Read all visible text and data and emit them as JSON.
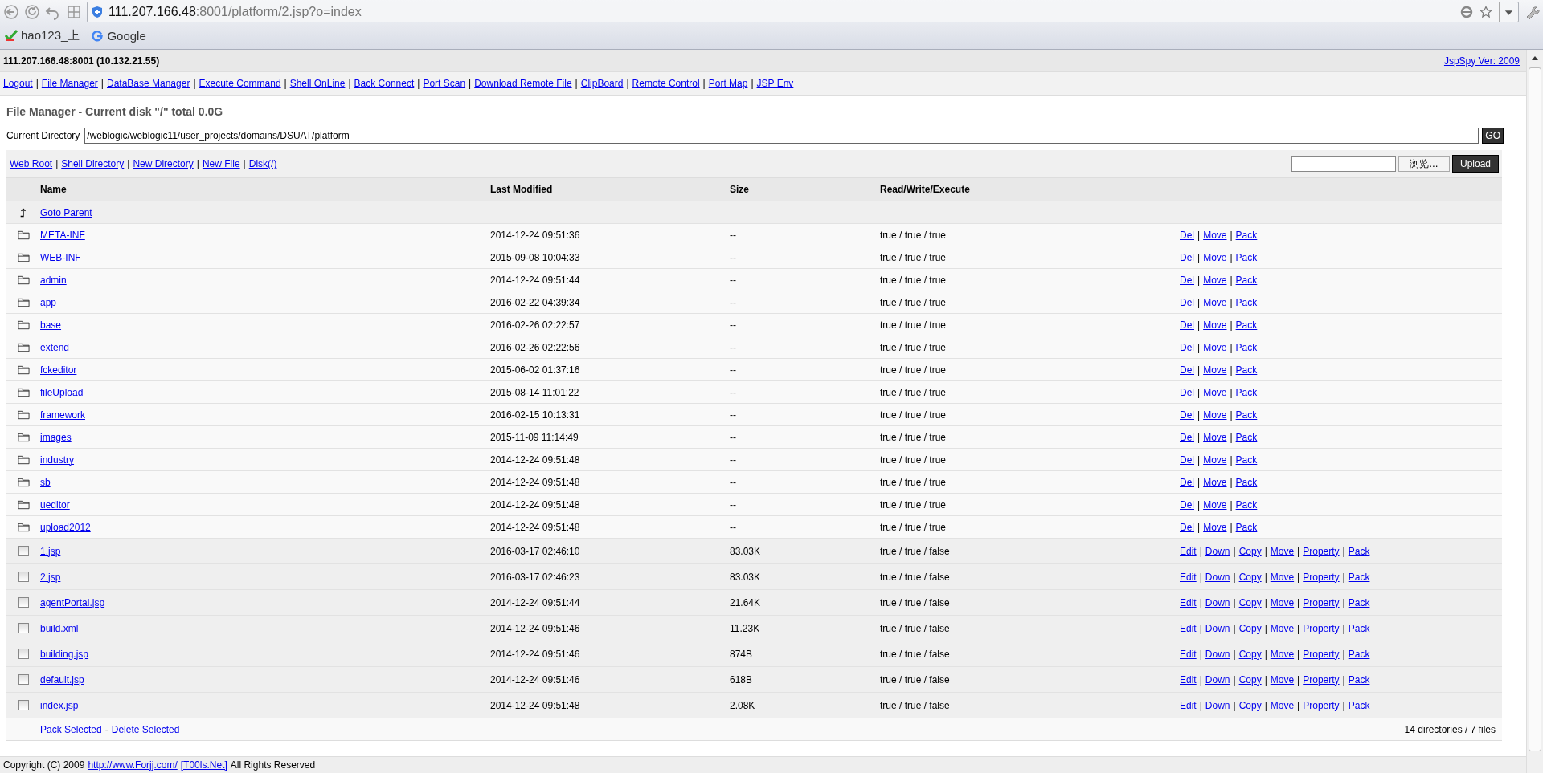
{
  "browser": {
    "url_host": "111.207.166.48",
    "url_path": ":8001/platform/2.jsp?o=index",
    "bookmarks": [
      {
        "label": "hao123_上",
        "kind": "check"
      },
      {
        "label": "Google",
        "kind": "letter"
      }
    ]
  },
  "header": {
    "host": "111.207.166.48:8001 (10.132.21.55)",
    "version_link": "JspSpy Ver: 2009"
  },
  "nav": {
    "separator": "|",
    "links": [
      "Logout",
      "File Manager",
      "DataBase Manager",
      "Execute Command",
      "Shell OnLine",
      "Back Connect",
      "Port Scan",
      "Download Remote File",
      "ClipBoard",
      "Remote Control",
      "Port Map",
      "JSP Env"
    ]
  },
  "title": "File Manager - Current disk \"/\" total 0.0G",
  "current_directory": {
    "label": "Current Directory",
    "value": "/weblogic/weblogic11/user_projects/domains/DSUAT/platform",
    "button": "GO"
  },
  "toolbar": {
    "separator": "|",
    "links": [
      "Web Root",
      "Shell Directory",
      "New Directory",
      "New File",
      "Disk(/)"
    ],
    "browse_button": "浏览...",
    "upload_button": "Upload"
  },
  "table": {
    "columns": [
      "Name",
      "Last Modified",
      "Size",
      "Read/Write/Execute"
    ],
    "parent_link": "Goto Parent",
    "separator": "|",
    "directories": [
      {
        "name": "META-INF",
        "modified": "2014-12-24 09:51:36",
        "size": "--",
        "permissions": "true / true / true",
        "actions": [
          "Del",
          "Move",
          "Pack"
        ]
      },
      {
        "name": "WEB-INF",
        "modified": "2015-09-08 10:04:33",
        "size": "--",
        "permissions": "true / true / true",
        "actions": [
          "Del",
          "Move",
          "Pack"
        ]
      },
      {
        "name": "admin",
        "modified": "2014-12-24 09:51:44",
        "size": "--",
        "permissions": "true / true / true",
        "actions": [
          "Del",
          "Move",
          "Pack"
        ]
      },
      {
        "name": "app",
        "modified": "2016-02-22 04:39:34",
        "size": "--",
        "permissions": "true / true / true",
        "actions": [
          "Del",
          "Move",
          "Pack"
        ]
      },
      {
        "name": "base",
        "modified": "2016-02-26 02:22:57",
        "size": "--",
        "permissions": "true / true / true",
        "actions": [
          "Del",
          "Move",
          "Pack"
        ]
      },
      {
        "name": "extend",
        "modified": "2016-02-26 02:22:56",
        "size": "--",
        "permissions": "true / true / true",
        "actions": [
          "Del",
          "Move",
          "Pack"
        ]
      },
      {
        "name": "fckeditor",
        "modified": "2015-06-02 01:37:16",
        "size": "--",
        "permissions": "true / true / true",
        "actions": [
          "Del",
          "Move",
          "Pack"
        ]
      },
      {
        "name": "fileUpload",
        "modified": "2015-08-14 11:01:22",
        "size": "--",
        "permissions": "true / true / true",
        "actions": [
          "Del",
          "Move",
          "Pack"
        ]
      },
      {
        "name": "framework",
        "modified": "2016-02-15 10:13:31",
        "size": "--",
        "permissions": "true / true / true",
        "actions": [
          "Del",
          "Move",
          "Pack"
        ]
      },
      {
        "name": "images",
        "modified": "2015-11-09 11:14:49",
        "size": "--",
        "permissions": "true / true / true",
        "actions": [
          "Del",
          "Move",
          "Pack"
        ]
      },
      {
        "name": "industry",
        "modified": "2014-12-24 09:51:48",
        "size": "--",
        "permissions": "true / true / true",
        "actions": [
          "Del",
          "Move",
          "Pack"
        ]
      },
      {
        "name": "sb",
        "modified": "2014-12-24 09:51:48",
        "size": "--",
        "permissions": "true / true / true",
        "actions": [
          "Del",
          "Move",
          "Pack"
        ]
      },
      {
        "name": "ueditor",
        "modified": "2014-12-24 09:51:48",
        "size": "--",
        "permissions": "true / true / true",
        "actions": [
          "Del",
          "Move",
          "Pack"
        ]
      },
      {
        "name": "upload2012",
        "modified": "2014-12-24 09:51:48",
        "size": "--",
        "permissions": "true / true / true",
        "actions": [
          "Del",
          "Move",
          "Pack"
        ]
      }
    ],
    "files": [
      {
        "name": "1.jsp",
        "modified": "2016-03-17 02:46:10",
        "size": "83.03K",
        "permissions": "true / true / false",
        "checked": false,
        "actions": [
          "Edit",
          "Down",
          "Copy",
          "Move",
          "Property",
          "Pack"
        ]
      },
      {
        "name": "2.jsp",
        "modified": "2016-03-17 02:46:23",
        "size": "83.03K",
        "permissions": "true / true / false",
        "checked": false,
        "actions": [
          "Edit",
          "Down",
          "Copy",
          "Move",
          "Property",
          "Pack"
        ]
      },
      {
        "name": "agentPortal.jsp",
        "modified": "2014-12-24 09:51:44",
        "size": "21.64K",
        "permissions": "true / true / false",
        "checked": false,
        "actions": [
          "Edit",
          "Down",
          "Copy",
          "Move",
          "Property",
          "Pack"
        ]
      },
      {
        "name": "build.xml",
        "modified": "2014-12-24 09:51:46",
        "size": "11.23K",
        "permissions": "true / true / false",
        "checked": false,
        "actions": [
          "Edit",
          "Down",
          "Copy",
          "Move",
          "Property",
          "Pack"
        ]
      },
      {
        "name": "building.jsp",
        "modified": "2014-12-24 09:51:46",
        "size": "874B",
        "permissions": "true / true / false",
        "checked": false,
        "actions": [
          "Edit",
          "Down",
          "Copy",
          "Move",
          "Property",
          "Pack"
        ]
      },
      {
        "name": "default.jsp",
        "modified": "2014-12-24 09:51:46",
        "size": "618B",
        "permissions": "true / true / false",
        "checked": false,
        "actions": [
          "Edit",
          "Down",
          "Copy",
          "Move",
          "Property",
          "Pack"
        ]
      },
      {
        "name": "index.jsp",
        "modified": "2014-12-24 09:51:48",
        "size": "2.08K",
        "permissions": "true / true / false",
        "checked": false,
        "actions": [
          "Edit",
          "Down",
          "Copy",
          "Move",
          "Property",
          "Pack"
        ]
      }
    ],
    "footer_links": [
      "Pack Selected",
      "Delete Selected"
    ],
    "footer_separator": "-",
    "summary": "14 directories / 7 files"
  },
  "copyright": {
    "text": "Copyright (C) 2009",
    "links": [
      "http://www.Forjj.com/",
      "[T00ls.Net]"
    ],
    "suffix": "All Rights Reserved"
  }
}
